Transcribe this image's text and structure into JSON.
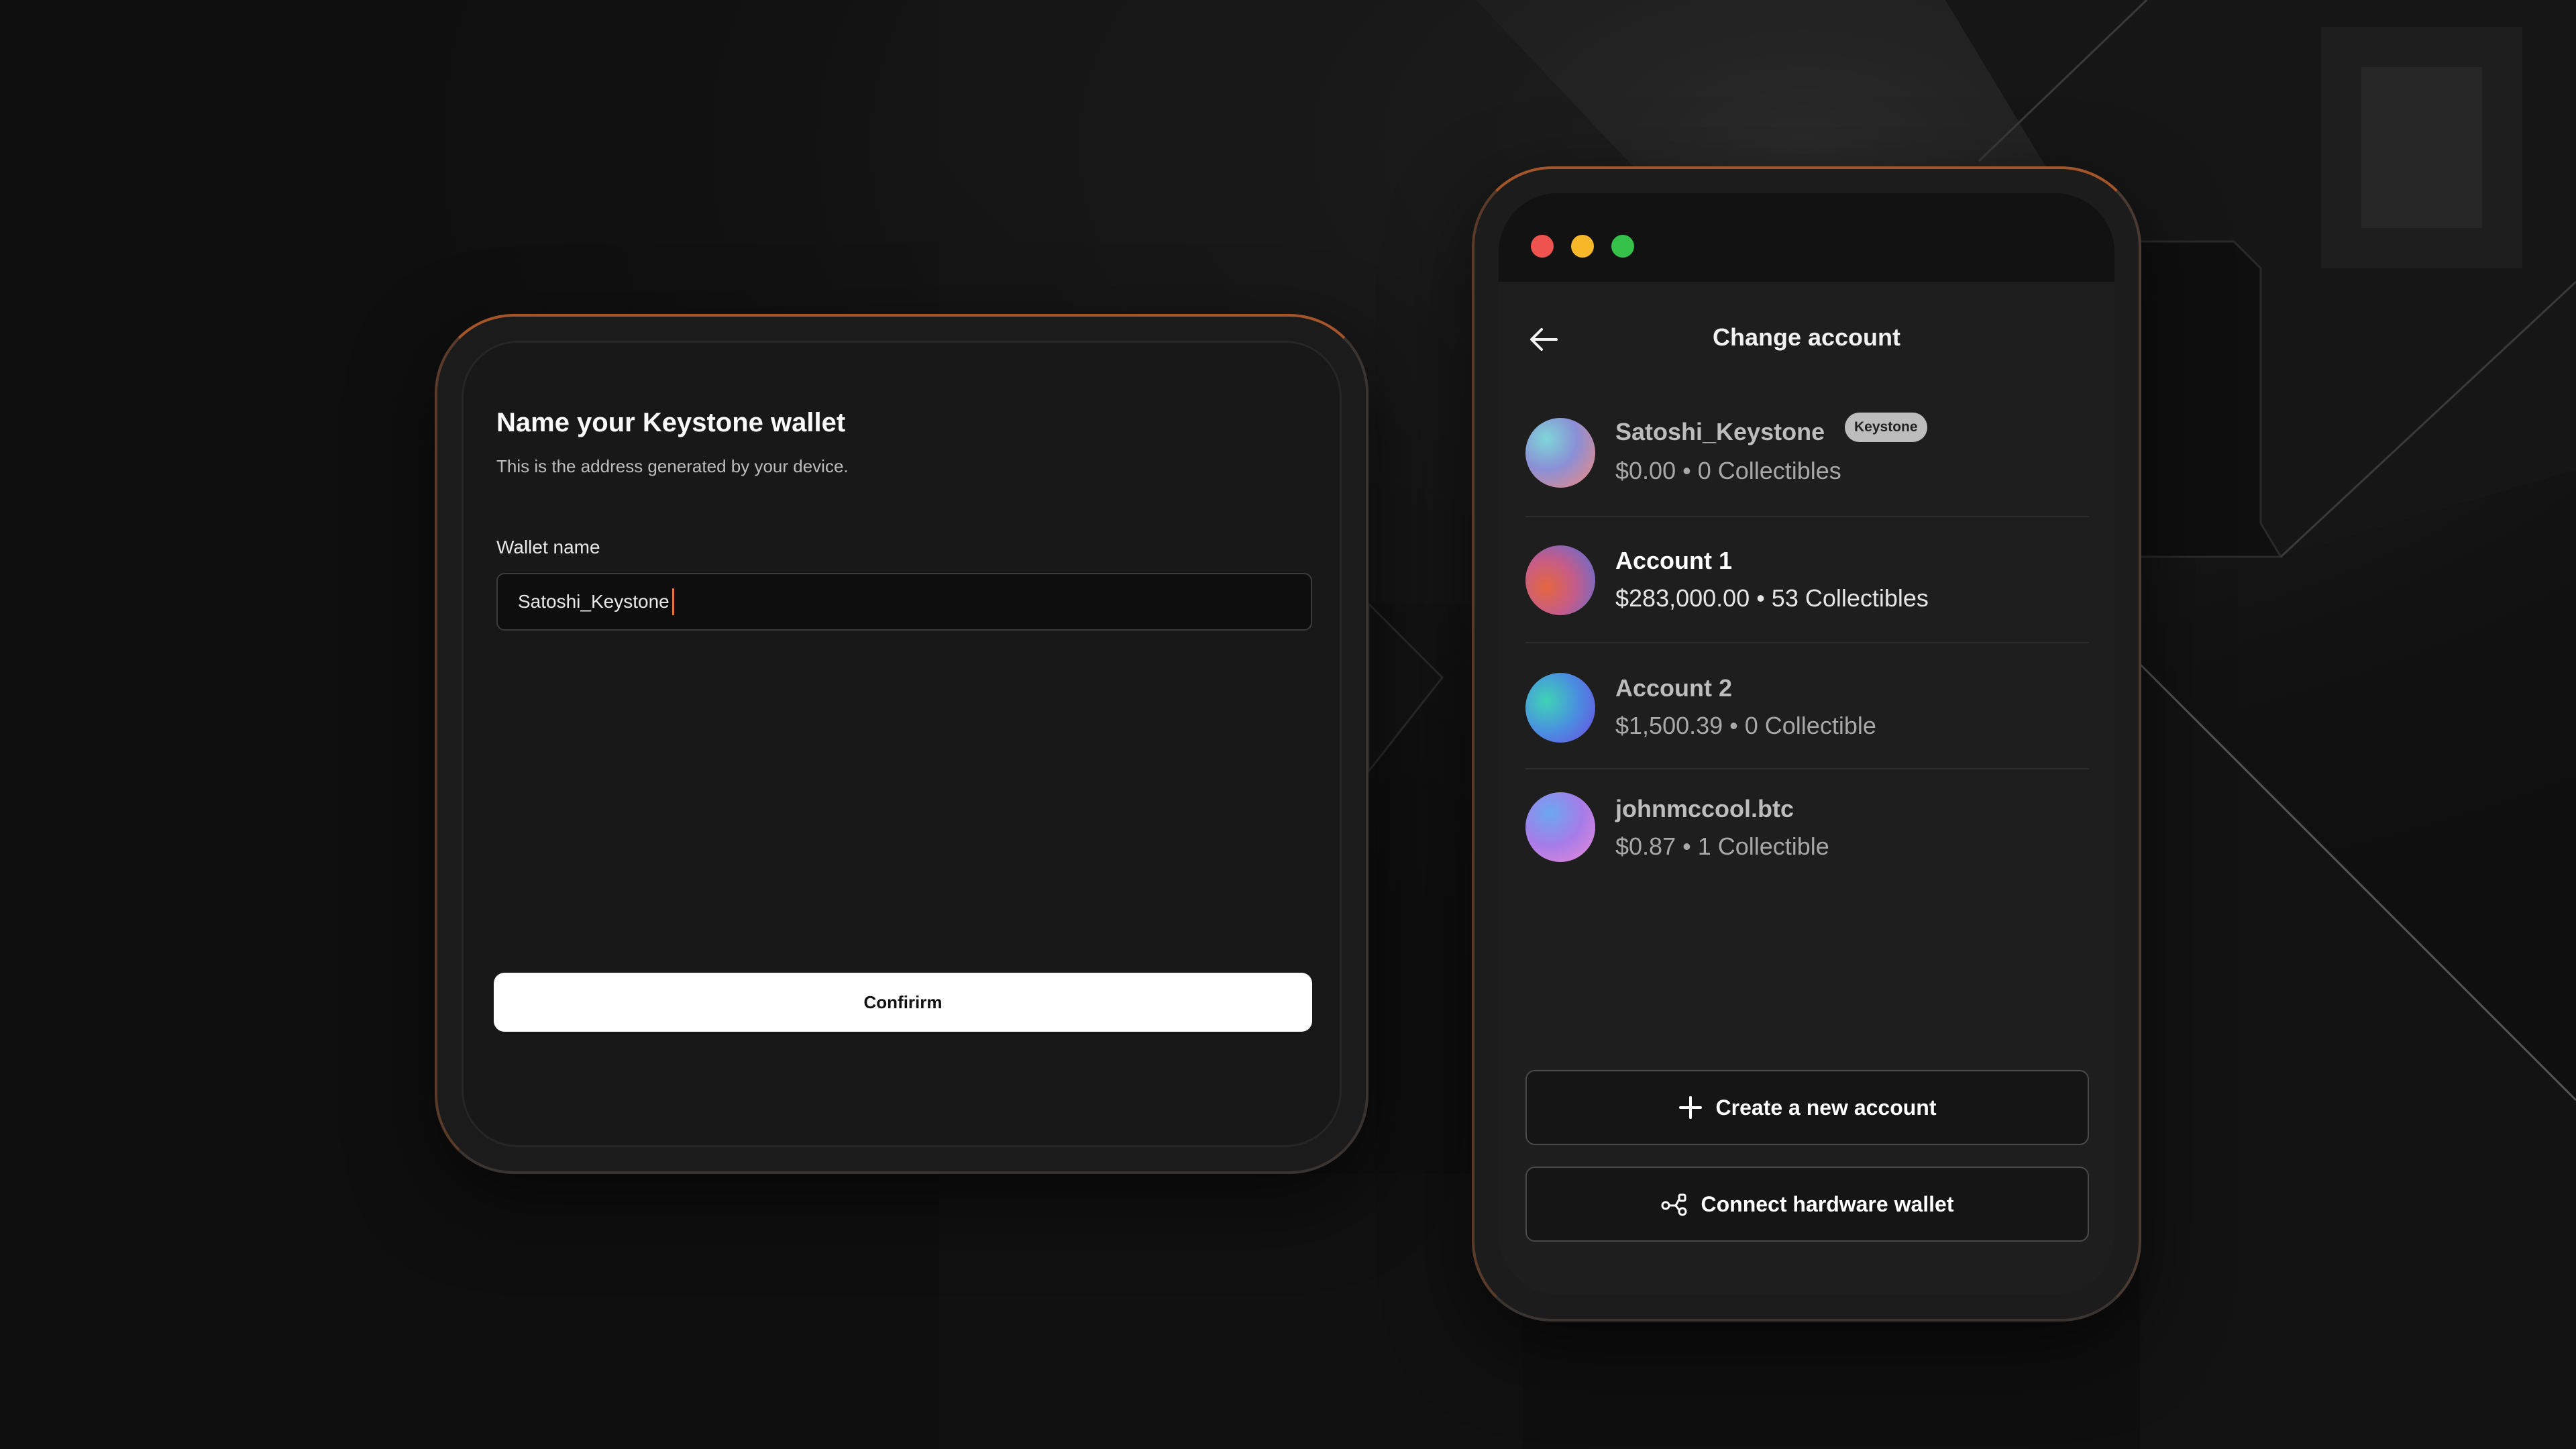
{
  "wallet_setup": {
    "title": "Name your Keystone wallet",
    "subtitle": "This is the address generated by your device.",
    "field_label": "Wallet name",
    "field_value": "Satoshi_Keystone",
    "confirm_label": "Confirirm"
  },
  "account_switcher": {
    "window_controls": [
      "close",
      "minimize",
      "zoom"
    ],
    "back_icon": "arrow-left-icon",
    "title": "Change account",
    "accounts": [
      {
        "name": "Satoshi_Keystone",
        "badge": "Keystone",
        "summary": "$0.00 • 0 Collectibles",
        "active": false
      },
      {
        "name": "Account 1",
        "summary": "$283,000.00 • 53 Collectibles",
        "active": true
      },
      {
        "name": "Account 2",
        "summary": "$1,500.39 • 0 Collectible",
        "active": false
      },
      {
        "name": "johnmccool.btc",
        "summary": "$0.87 • 1 Collectible",
        "active": false
      }
    ],
    "create_account_label": "Create a new account",
    "create_account_icon": "plus-icon",
    "connect_hardware_label": "Connect hardware wallet",
    "connect_hardware_icon": "hardware-connect-icon"
  },
  "colors": {
    "background": "#0f0f0f",
    "accent": "#e2733a",
    "device_frame": "#1b1b1b",
    "button_primary": "#ffffff"
  }
}
